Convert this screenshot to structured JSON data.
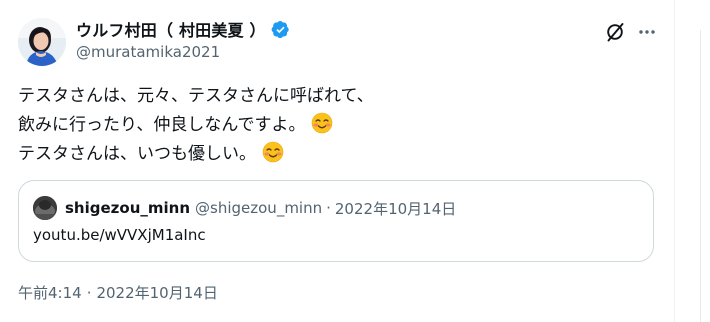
{
  "author": {
    "display_name": "ウルフ村田（ 村田美夏 ）",
    "handle": "@muratamika2021",
    "verified": true,
    "verified_color": "#1d9bf0"
  },
  "actions": {
    "grok_icon": "grok-icon",
    "more_icon": "more-dots-icon"
  },
  "tweet": {
    "lines": [
      "テスタさんは、元々、テスタさんに呼ばれて、",
      "飲みに行ったり、仲良しなんですよ。",
      "テスタさんは、いつも優しい。"
    ],
    "emoji_name": "smiling-face-with-blush"
  },
  "quote": {
    "display_name": "shigezou_minn",
    "handle": "@shigezou_minn",
    "separator": "·",
    "date": "2022年10月14日",
    "text": "youtu.be/wVVXjM1aInc"
  },
  "meta": {
    "time": "午前4:14",
    "separator": "·",
    "date": "2022年10月14日"
  },
  "colors": {
    "text_primary": "#0f1419",
    "text_secondary": "#536471",
    "border": "#cfd9de",
    "accent": "#1d9bf0"
  }
}
